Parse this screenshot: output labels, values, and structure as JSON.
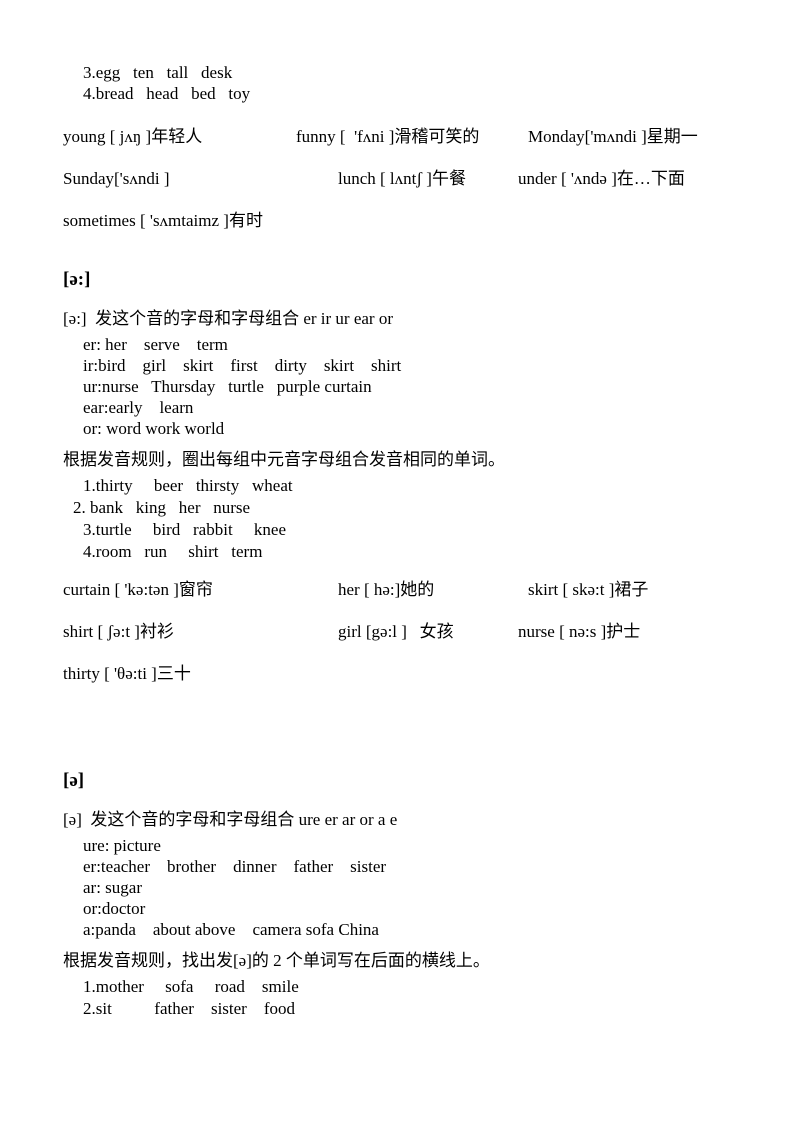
{
  "top_exercise": {
    "lines": [
      "3.egg   ten   tall   desk",
      "4.bread   head   bed   toy"
    ]
  },
  "vocab_ʌ": {
    "rows": [
      {
        "c1": "young [ jʌŋ ]年轻人",
        "c2": "funny [  'fʌni ]滑稽可笑的",
        "c3": "Monday['mʌndi ]星期一"
      },
      {
        "c1": "Sunday['sʌndi ]",
        "c2": "lunch [ lʌntʃ ]午餐",
        "c3": "under [ 'ʌndə ]在…下面"
      },
      {
        "c1": "sometimes [ 'sʌmtaimz ]有时",
        "c2": "",
        "c3": ""
      }
    ]
  },
  "section_er": {
    "heading": "[ə:]",
    "rule": "[ə:]  发这个音的字母和字母组合 er ir ur ear or",
    "patterns": [
      "er: her    serve    term",
      "ir:bird    girl    skirt    first    dirty    skirt    shirt",
      "ur:nurse   Thursday   turtle   purple curtain",
      "ear:early    learn",
      "or: word work world"
    ],
    "instruction": "根据发音规则，圈出每组中元音字母组合发音相同的单词。",
    "exercises": [
      "1.thirty     beer   thirsty   wheat",
      "2. bank   king   her   nurse",
      "3.turtle     bird   rabbit     knee",
      "4.room   run     shirt   term"
    ],
    "vocab_rows": [
      {
        "c1": "curtain [ 'kə:tən ]窗帘",
        "c2": "her [ hə:]她的",
        "c3": "skirt [ skə:t ]裙子"
      },
      {
        "c1": "shirt [ ʃə:t ]衬衫",
        "c2": "girl [gə:l ]   女孩",
        "c3": "nurse [ nə:s ]护士"
      },
      {
        "c1": "thirty [ 'θə:ti ]三十",
        "c2": "",
        "c3": ""
      }
    ]
  },
  "section_schwa": {
    "heading": "[ə]",
    "rule": "[ə]  发这个音的字母和字母组合 ure er ar or a e",
    "patterns": [
      "ure: picture",
      "er:teacher    brother    dinner    father    sister",
      "ar: sugar",
      "or:doctor",
      "a:panda    about above    camera sofa China"
    ],
    "instruction": "根据发音规则，找出发[ə]的 2 个单词写在后面的横线上。",
    "exercises": [
      "1.mother     sofa     road    smile",
      "2.sit          father    sister    food"
    ]
  }
}
